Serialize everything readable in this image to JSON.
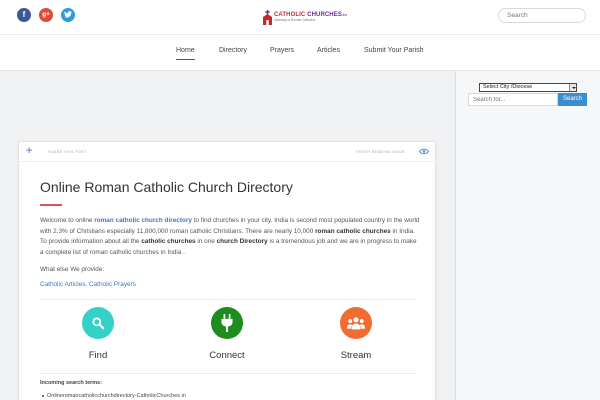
{
  "header": {
    "social": {
      "facebook": "f",
      "google_plus": "g+"
    },
    "logo": {
      "part1": "CATHOLIC",
      "part2": "CHURCHES",
      "suffix": ".in",
      "tagline": "Gateway of Roman Catholics"
    },
    "search_placeholder": "Search"
  },
  "nav": {
    "items": [
      "Home",
      "Directory",
      "Prayers",
      "Articles",
      "Submit Your Parish"
    ],
    "active": "Home"
  },
  "sidebar": {
    "select_value": "Select City /Diocese",
    "search_placeholder": "Search for...",
    "search_button": "Search"
  },
  "post": {
    "share_label": "SHARE THIS POST",
    "reading_mode_label": "ENTER READING MODE",
    "title": "Online Roman Catholic Church Directory",
    "para": {
      "t1": "Welcome to online ",
      "link1": "roman catholic church directory",
      "t2": " to find churches in your city. India is second most populated country in the world with 2.3% of Christians especially 11,800,000 roman catholic Christians. There are nearly 10,000 ",
      "b1": "roman catholic churches",
      "t3": " in India. To provide information about all the ",
      "b2": "catholic churches",
      "t4": " in one ",
      "b3": "church Directory",
      "t5": " is a tremendous job and we are in progress to make a complete list of roman catholic churches in India ."
    },
    "provide": "What else We provide:",
    "links": "Catholic Articles, Catholic Prayers",
    "features": [
      {
        "label": "Find",
        "icon": "search-icon",
        "color": "#34d1c8"
      },
      {
        "label": "Connect",
        "icon": "plug-icon",
        "color": "#1e8c1e"
      },
      {
        "label": "Stream",
        "icon": "group-icon",
        "color": "#f06c33"
      }
    ],
    "incoming_label": "Incoming search terms:",
    "search_terms": [
      "Onlineromancatholicchurchdirectory-CatholicChurches in"
    ]
  },
  "colors": {
    "accent": "#3a8ed0",
    "title_rule": "#d9534f",
    "link": "#3a7bc0"
  }
}
